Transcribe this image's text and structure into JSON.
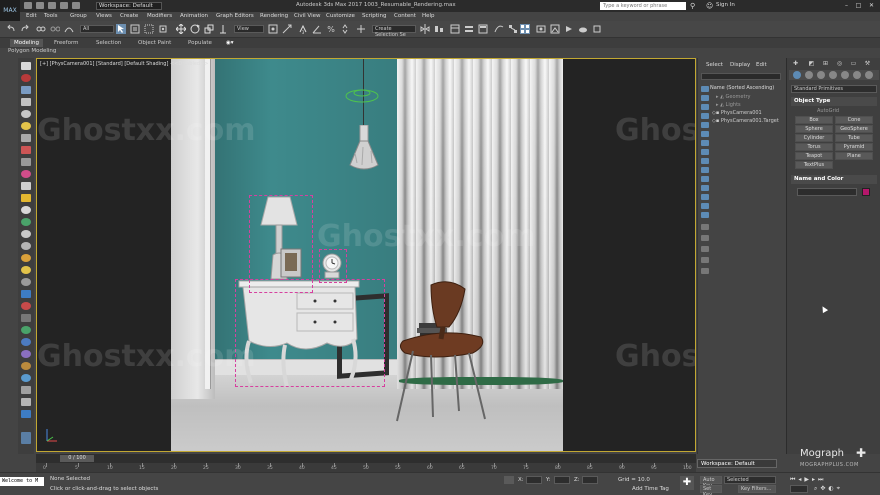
{
  "titlebar": {
    "logo": "MAX",
    "workspace_select": "Workspace: Default",
    "title": "Autodesk 3ds Max 2017     1003_Resumable_Rendering.max",
    "search_placeholder": "Type a keyword or phrase",
    "sign_in": "Sign In"
  },
  "menubar": {
    "items": [
      "Edit",
      "Tools",
      "Group",
      "Views",
      "Create",
      "Modifiers",
      "Animation",
      "Graph Editors",
      "Rendering",
      "Civil View",
      "Customize",
      "Scripting",
      "Content",
      "Help"
    ]
  },
  "toolbar": {
    "filter_select": "All",
    "view_select": "View",
    "selection_set": "Create Selection Se"
  },
  "ribbon": {
    "tabs": [
      "Modeling",
      "Freeform",
      "Selection",
      "Object Paint",
      "Populate"
    ],
    "active_tab": "Modeling",
    "sub_label": "Polygon Modeling"
  },
  "viewport": {
    "label": "[+] [PhysCamera001] [Standard] [Default Shading]  <<Disabled>>",
    "watermark": "Ghostxx.com"
  },
  "explorer": {
    "tabs": [
      "Select",
      "Display",
      "Edit"
    ],
    "column_header": "Name (Sorted Ascending)",
    "rows": [
      "Geometry",
      "Lights",
      "PhysCamera001",
      "PhysCamera001.Target"
    ]
  },
  "command_panel": {
    "dropdown": "Standard Primitives",
    "object_type_header": "Object Type",
    "autogrid": "AutoGrid",
    "primitives": [
      "Box",
      "Cone",
      "Sphere",
      "GeoSphere",
      "Cylinder",
      "Tube",
      "Torus",
      "Pyramid",
      "Teapot",
      "Plane",
      "TextPlus"
    ],
    "name_color_header": "Name and Color",
    "swatch_color": "#b5176b"
  },
  "workspace_bar": "Workspace: Default",
  "mograph": {
    "brand": "Mograph",
    "url": "MOGRAPHPLUS.COM"
  },
  "timeline": {
    "frame_indicator": "0 / 100",
    "ticks": [
      "0",
      "5",
      "10",
      "15",
      "20",
      "25",
      "30",
      "35",
      "40",
      "45",
      "50",
      "55",
      "60",
      "65",
      "70",
      "75",
      "80",
      "85",
      "90",
      "95",
      "100"
    ]
  },
  "status": {
    "maxscript": "Welcome to M",
    "selected": "None Selected",
    "prompt": "Click or click-and-drag to select objects",
    "x_label": "X:",
    "y_label": "Y:",
    "z_label": "Z:",
    "grid": "Grid = 10.0",
    "add_time_tag": "Add Time Tag",
    "auto_key": "Auto Key",
    "selected_dropdown": "Selected",
    "set_key": "Set Key",
    "key_filters": "Key Filters..."
  }
}
